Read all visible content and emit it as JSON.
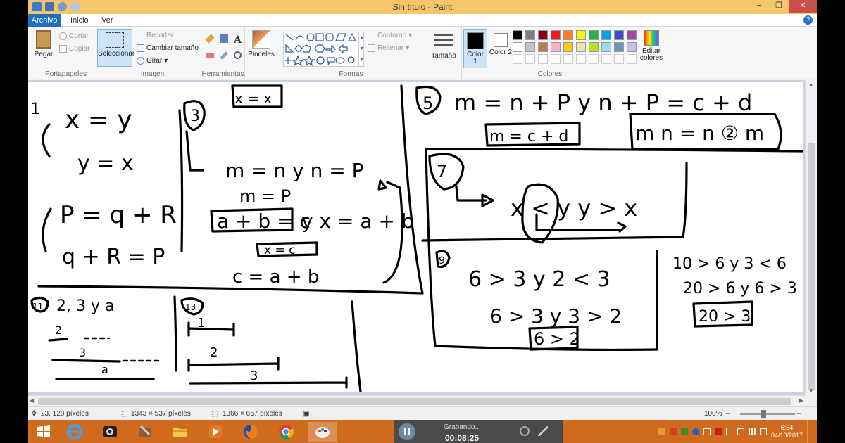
{
  "window": {
    "title": "Sin título - Paint",
    "controls": [
      "−",
      "❐",
      "✕"
    ]
  },
  "tabs": [
    "Archivo",
    "Inicio",
    "Ver"
  ],
  "ribbon": {
    "clipboard": {
      "paste": "Pegar",
      "cut": "Cortar",
      "copy": "Copiar",
      "group": "Portapapeles"
    },
    "image": {
      "select": "Seleccionar",
      "crop": "Recortar",
      "resize": "Cambiar tamaño",
      "rotate": "Girar",
      "group": "Imagen"
    },
    "tools": {
      "group": "Herramientas",
      "text_tool": "A"
    },
    "brushes": {
      "label": "Pinceles"
    },
    "shapes": {
      "outline": "Contorno",
      "fill": "Rellenar",
      "group": "Formas"
    },
    "size": {
      "label": "Tamaño"
    },
    "colors": {
      "color1": "Color 1",
      "color2": "Color 2",
      "edit": "Editar colores",
      "group": "Colores",
      "color1_value": "#000000",
      "color2_value": "#ffffff",
      "palette": [
        "#000000",
        "#7f7f7f",
        "#880015",
        "#ed1c24",
        "#ff7f27",
        "#fff200",
        "#22b14c",
        "#00a2e8",
        "#3f48cc",
        "#a349a4",
        "#ffffff",
        "#c3c3c3",
        "#b97a57",
        "#ffaec9",
        "#ffc90e",
        "#efe4b0",
        "#b5e61d",
        "#99d9ea",
        "#7092be",
        "#c8bfe7",
        "#ffffff",
        "#ffffff",
        "#ffffff",
        "#ffffff",
        "#ffffff",
        "#ffffff",
        "#ffffff",
        "#ffffff",
        "#ffffff",
        "#ffffff"
      ]
    }
  },
  "handwriting": {
    "p1_number": "1",
    "p1_eq1": "x = y",
    "p1_eq2": "y = x",
    "p1_eq3": "P = q + R",
    "p1_eq4": "q + R = P",
    "p2_box": "x = x",
    "p3_number": "3",
    "p3_eq1": "m = n y n = P",
    "p3_eq2": "m = P",
    "p3_box": "a + b = c",
    "p3_eq3": "y x = a + b",
    "p3_box2": "x = c",
    "p3_eq4": "c = a + b",
    "p5_number": "5",
    "p5_eq1": "m = n + P y n + P = c + d",
    "p5_box1": "m = c + d",
    "p5_box2": "m n = n ② m",
    "p7_number": "7",
    "p7_eq": "x < y   y > x",
    "p9_number": "9",
    "p9_eq1": "6 > 3   y 2 < 3",
    "p9_eq2": "6 > 3 y 3 > 2",
    "p9_box": "6 > 2",
    "right_eq1": "10 > 6 y 3 < 6",
    "right_eq2": "20 > 6 y 6 > 3",
    "right_box": "20 > 3",
    "p11_number": "11",
    "p11_eq": "2, 3 y a",
    "p11_l1": "2",
    "p11_l2": "3",
    "p11_l3": "a",
    "p13_number": "13",
    "p13_l1": "1",
    "p13_l2": "2",
    "p13_l3": "3"
  },
  "status": {
    "cursor": "23, 120 píxeles",
    "selection": "1343 × 537 píxeles",
    "size": "1366 × 657 píxeles",
    "zoom": "100%",
    "zoom_minus": "−",
    "zoom_plus": "+"
  },
  "taskbar": {
    "recording_label": "Grabando...",
    "recording_time": "00:08:25",
    "time": "6:54",
    "date": "04/10/2017"
  }
}
